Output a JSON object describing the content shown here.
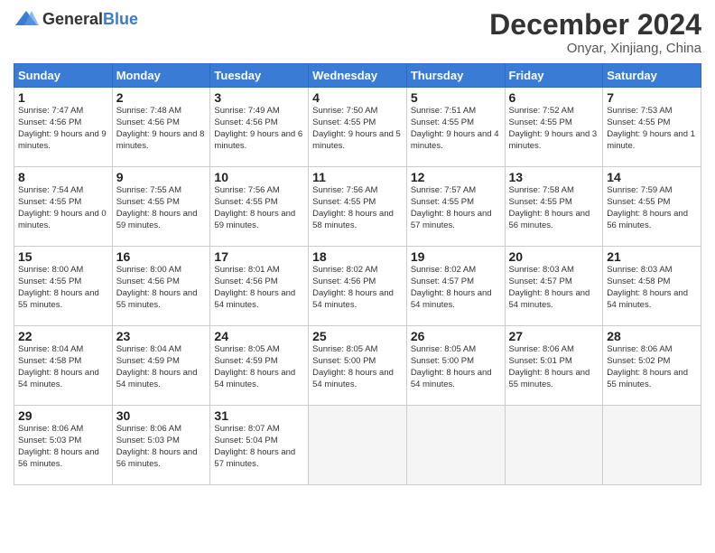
{
  "header": {
    "logo_general": "General",
    "logo_blue": "Blue",
    "month_title": "December 2024",
    "location": "Onyar, Xinjiang, China"
  },
  "days_of_week": [
    "Sunday",
    "Monday",
    "Tuesday",
    "Wednesday",
    "Thursday",
    "Friday",
    "Saturday"
  ],
  "weeks": [
    [
      {
        "day": "1",
        "sunrise": "7:47 AM",
        "sunset": "4:56 PM",
        "daylight": "9 hours and 9 minutes."
      },
      {
        "day": "2",
        "sunrise": "7:48 AM",
        "sunset": "4:56 PM",
        "daylight": "9 hours and 8 minutes."
      },
      {
        "day": "3",
        "sunrise": "7:49 AM",
        "sunset": "4:56 PM",
        "daylight": "9 hours and 6 minutes."
      },
      {
        "day": "4",
        "sunrise": "7:50 AM",
        "sunset": "4:55 PM",
        "daylight": "9 hours and 5 minutes."
      },
      {
        "day": "5",
        "sunrise": "7:51 AM",
        "sunset": "4:55 PM",
        "daylight": "9 hours and 4 minutes."
      },
      {
        "day": "6",
        "sunrise": "7:52 AM",
        "sunset": "4:55 PM",
        "daylight": "9 hours and 3 minutes."
      },
      {
        "day": "7",
        "sunrise": "7:53 AM",
        "sunset": "4:55 PM",
        "daylight": "9 hours and 1 minute."
      }
    ],
    [
      {
        "day": "8",
        "sunrise": "7:54 AM",
        "sunset": "4:55 PM",
        "daylight": "9 hours and 0 minutes."
      },
      {
        "day": "9",
        "sunrise": "7:55 AM",
        "sunset": "4:55 PM",
        "daylight": "8 hours and 59 minutes."
      },
      {
        "day": "10",
        "sunrise": "7:56 AM",
        "sunset": "4:55 PM",
        "daylight": "8 hours and 59 minutes."
      },
      {
        "day": "11",
        "sunrise": "7:56 AM",
        "sunset": "4:55 PM",
        "daylight": "8 hours and 58 minutes."
      },
      {
        "day": "12",
        "sunrise": "7:57 AM",
        "sunset": "4:55 PM",
        "daylight": "8 hours and 57 minutes."
      },
      {
        "day": "13",
        "sunrise": "7:58 AM",
        "sunset": "4:55 PM",
        "daylight": "8 hours and 56 minutes."
      },
      {
        "day": "14",
        "sunrise": "7:59 AM",
        "sunset": "4:55 PM",
        "daylight": "8 hours and 56 minutes."
      }
    ],
    [
      {
        "day": "15",
        "sunrise": "8:00 AM",
        "sunset": "4:55 PM",
        "daylight": "8 hours and 55 minutes."
      },
      {
        "day": "16",
        "sunrise": "8:00 AM",
        "sunset": "4:56 PM",
        "daylight": "8 hours and 55 minutes."
      },
      {
        "day": "17",
        "sunrise": "8:01 AM",
        "sunset": "4:56 PM",
        "daylight": "8 hours and 54 minutes."
      },
      {
        "day": "18",
        "sunrise": "8:02 AM",
        "sunset": "4:56 PM",
        "daylight": "8 hours and 54 minutes."
      },
      {
        "day": "19",
        "sunrise": "8:02 AM",
        "sunset": "4:57 PM",
        "daylight": "8 hours and 54 minutes."
      },
      {
        "day": "20",
        "sunrise": "8:03 AM",
        "sunset": "4:57 PM",
        "daylight": "8 hours and 54 minutes."
      },
      {
        "day": "21",
        "sunrise": "8:03 AM",
        "sunset": "4:58 PM",
        "daylight": "8 hours and 54 minutes."
      }
    ],
    [
      {
        "day": "22",
        "sunrise": "8:04 AM",
        "sunset": "4:58 PM",
        "daylight": "8 hours and 54 minutes."
      },
      {
        "day": "23",
        "sunrise": "8:04 AM",
        "sunset": "4:59 PM",
        "daylight": "8 hours and 54 minutes."
      },
      {
        "day": "24",
        "sunrise": "8:05 AM",
        "sunset": "4:59 PM",
        "daylight": "8 hours and 54 minutes."
      },
      {
        "day": "25",
        "sunrise": "8:05 AM",
        "sunset": "5:00 PM",
        "daylight": "8 hours and 54 minutes."
      },
      {
        "day": "26",
        "sunrise": "8:05 AM",
        "sunset": "5:00 PM",
        "daylight": "8 hours and 54 minutes."
      },
      {
        "day": "27",
        "sunrise": "8:06 AM",
        "sunset": "5:01 PM",
        "daylight": "8 hours and 55 minutes."
      },
      {
        "day": "28",
        "sunrise": "8:06 AM",
        "sunset": "5:02 PM",
        "daylight": "8 hours and 55 minutes."
      }
    ],
    [
      {
        "day": "29",
        "sunrise": "8:06 AM",
        "sunset": "5:03 PM",
        "daylight": "8 hours and 56 minutes."
      },
      {
        "day": "30",
        "sunrise": "8:06 AM",
        "sunset": "5:03 PM",
        "daylight": "8 hours and 56 minutes."
      },
      {
        "day": "31",
        "sunrise": "8:07 AM",
        "sunset": "5:04 PM",
        "daylight": "8 hours and 57 minutes."
      },
      null,
      null,
      null,
      null
    ]
  ]
}
